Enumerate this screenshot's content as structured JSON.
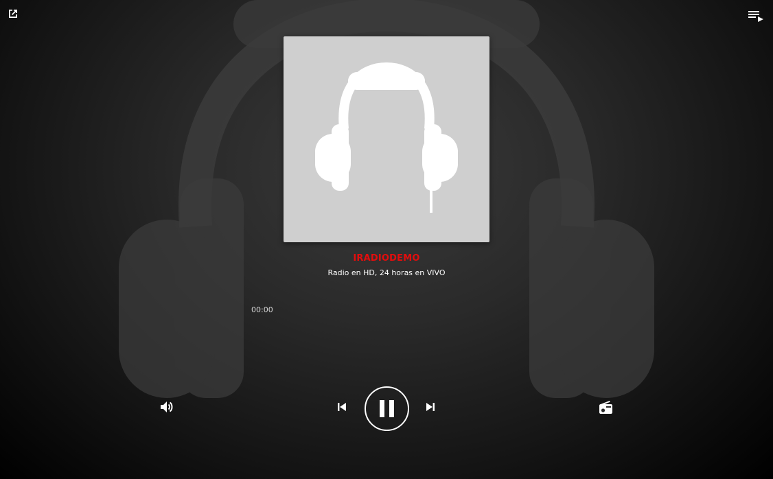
{
  "header": {
    "popout_icon": "open-in-new-icon",
    "playlist_icon": "playlist-play-icon"
  },
  "station": {
    "name": "IRADIODEMO",
    "subtitle": "Radio en HD, 24 horas en VIVO",
    "cover_icon": "headphones-icon"
  },
  "player": {
    "elapsed": "00:00",
    "state": "playing"
  },
  "controls": {
    "volume_icon": "volume-up-icon",
    "previous_icon": "skip-previous-icon",
    "pause_icon": "pause-icon",
    "next_icon": "skip-next-icon",
    "radio_icon": "radio-icon"
  },
  "colors": {
    "accent": "#e30d0d",
    "text": "#ffffff",
    "cover_bg": "#cfcfcf"
  }
}
